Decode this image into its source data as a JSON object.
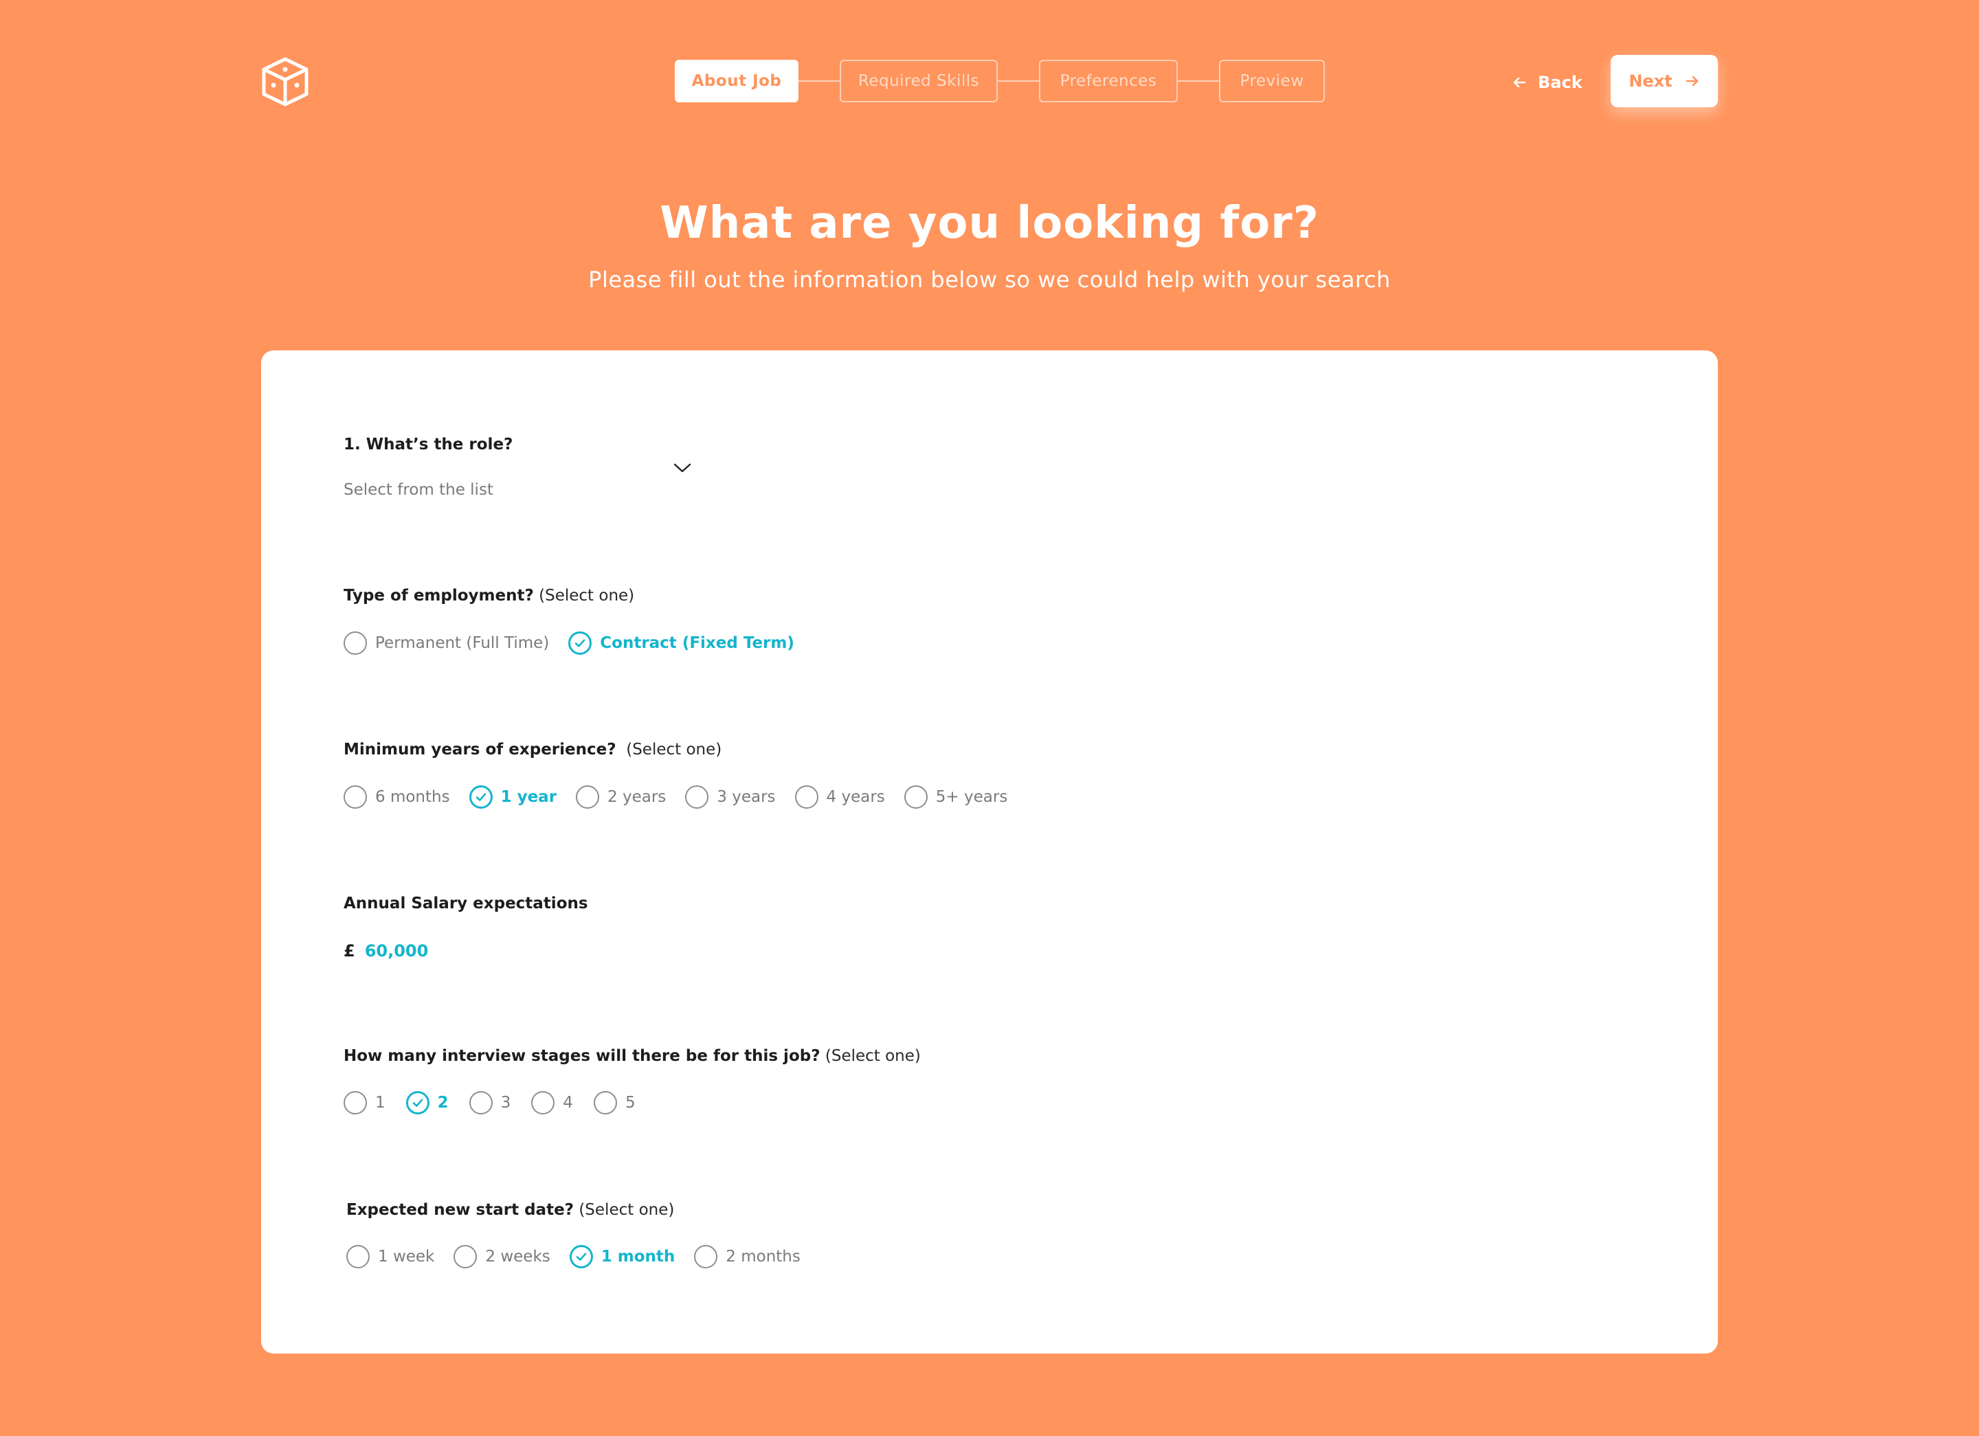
{
  "header": {
    "logo_icon": "dice-cube-icon",
    "steps": [
      {
        "label": "About Job"
      },
      {
        "label": "Required Skills"
      },
      {
        "label": "Preferences"
      },
      {
        "label": "Preview"
      }
    ],
    "active_step": 0,
    "back_label": "Back",
    "next_label": "Next"
  },
  "hero": {
    "title": "What are you looking for?",
    "subtitle": "Please fill out the information below so we could help with your search"
  },
  "form": {
    "role": {
      "label": "1. What’s the role?",
      "placeholder": "Select from the list"
    },
    "employment": {
      "label": "Type of employment?",
      "hint": "(Select one)",
      "options": [
        "Permanent (Full Time)",
        "Contract (Fixed Term)"
      ],
      "selected": 1
    },
    "experience": {
      "label": "Minimum years of experience?",
      "hint": "(Select one)",
      "options": [
        "6 months",
        "1 year",
        "2 years",
        "3 years",
        "4 years",
        "5+ years"
      ],
      "selected": 1
    },
    "salary": {
      "label": "Annual Salary expectations",
      "currency": "£",
      "value": "60,000"
    },
    "stages": {
      "label": "How many interview stages will there be for this job?",
      "hint": "(Select one)",
      "options": [
        "1",
        "2",
        "3",
        "4",
        "5"
      ],
      "selected": 1
    },
    "start_date": {
      "label": "Expected new start date?",
      "hint": "(Select one)",
      "options": [
        "1 week",
        "2 weeks",
        "1 month",
        "2 months"
      ],
      "selected": 2
    }
  },
  "colors": {
    "background": "#FF945C",
    "accent": "#13B5CC",
    "card": "#FFFFFF"
  }
}
